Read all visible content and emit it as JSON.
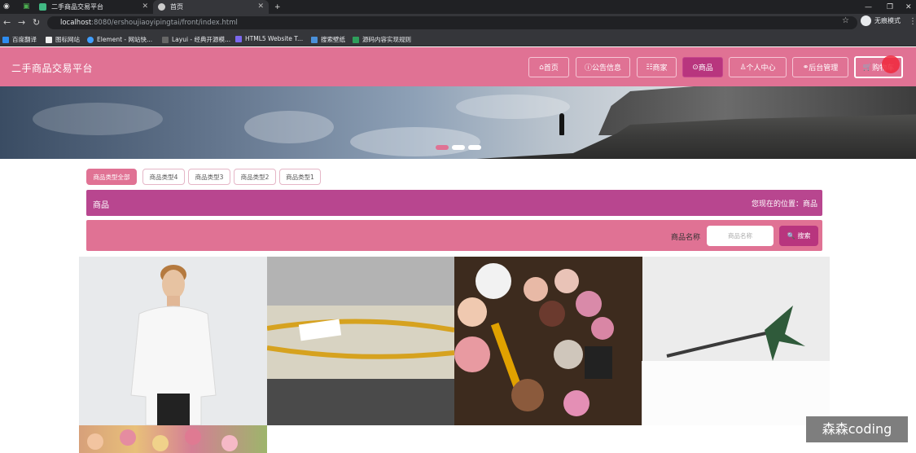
{
  "browser": {
    "tabs": [
      {
        "label": "二手商品交易平台",
        "active": false
      },
      {
        "label": "首页",
        "active": true
      }
    ],
    "url_host": "localhost",
    "url_path": ":8080/ershoujiaoyipingtai/front/index.html",
    "profile_label": "无痕模式",
    "bookmarks": [
      "百度翻译",
      "图标网站",
      "Element - 网站快...",
      "Layui - 经典开源模...",
      "HTML5 Website T...",
      "搜索壁纸",
      "源码内容实现规则"
    ]
  },
  "header": {
    "title": "二手商品交易平台",
    "nav": [
      "首页",
      "公告信息",
      "商家",
      "商品",
      "个人中心",
      "后台管理",
      "购物车"
    ],
    "active_nav": "商品"
  },
  "banner": {
    "slides": 3,
    "active_slide": 1
  },
  "categories": {
    "items": [
      "商品类型全部",
      "商品类型4",
      "商品类型3",
      "商品类型2",
      "商品类型1"
    ],
    "active": "商品类型全部"
  },
  "breadcrumb": {
    "title": "商品",
    "location": "您现在的位置：商品"
  },
  "search": {
    "label": "商品名称",
    "placeholder": "商品名称",
    "button": "搜索"
  },
  "colors": {
    "primary": "#e07294",
    "accent": "#b8357e"
  },
  "watermark": "森森coding"
}
